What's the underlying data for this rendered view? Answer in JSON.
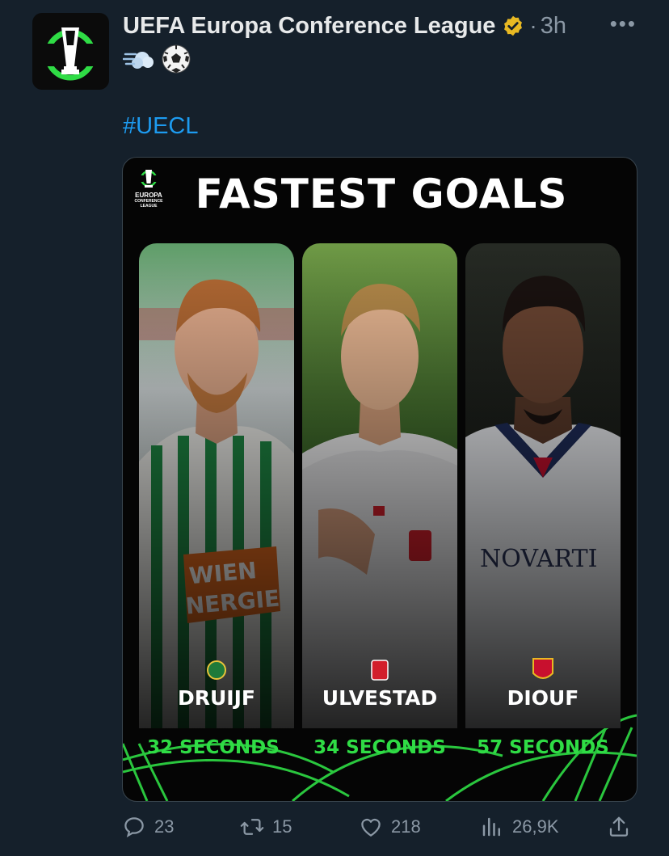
{
  "tweet": {
    "author_name": "UEFA Europa Conference League",
    "separator": "·",
    "time": "3h",
    "more": "•••",
    "emojis": [
      "dash-emoji",
      "soccer-ball-emoji"
    ],
    "hashtag": "#UECL"
  },
  "media": {
    "title": "FASTEST GOALS",
    "logo_text": [
      "EUROPA",
      "CONFERENCE",
      "LEAGUE"
    ],
    "players": [
      {
        "name": "DRUIJF",
        "time": "32 SECONDS",
        "sponsor": "WIEN NERGIE",
        "crest_color": "#1f7a3a"
      },
      {
        "name": "ULVESTAD",
        "time": "34 SECONDS",
        "sponsor": "",
        "crest_color": "#d21f2b"
      },
      {
        "name": "DIOUF",
        "time": "57 SECONDS",
        "sponsor": "NOVARTI",
        "crest_color": "#c8102e"
      }
    ],
    "accent_color": "#2fdc45"
  },
  "actions": {
    "replies": "23",
    "retweets": "15",
    "likes": "218",
    "views": "26,9K"
  },
  "colors": {
    "background": "#15202b",
    "link": "#1d9bf0",
    "muted": "#8b98a5",
    "verified": "#e8b923"
  }
}
